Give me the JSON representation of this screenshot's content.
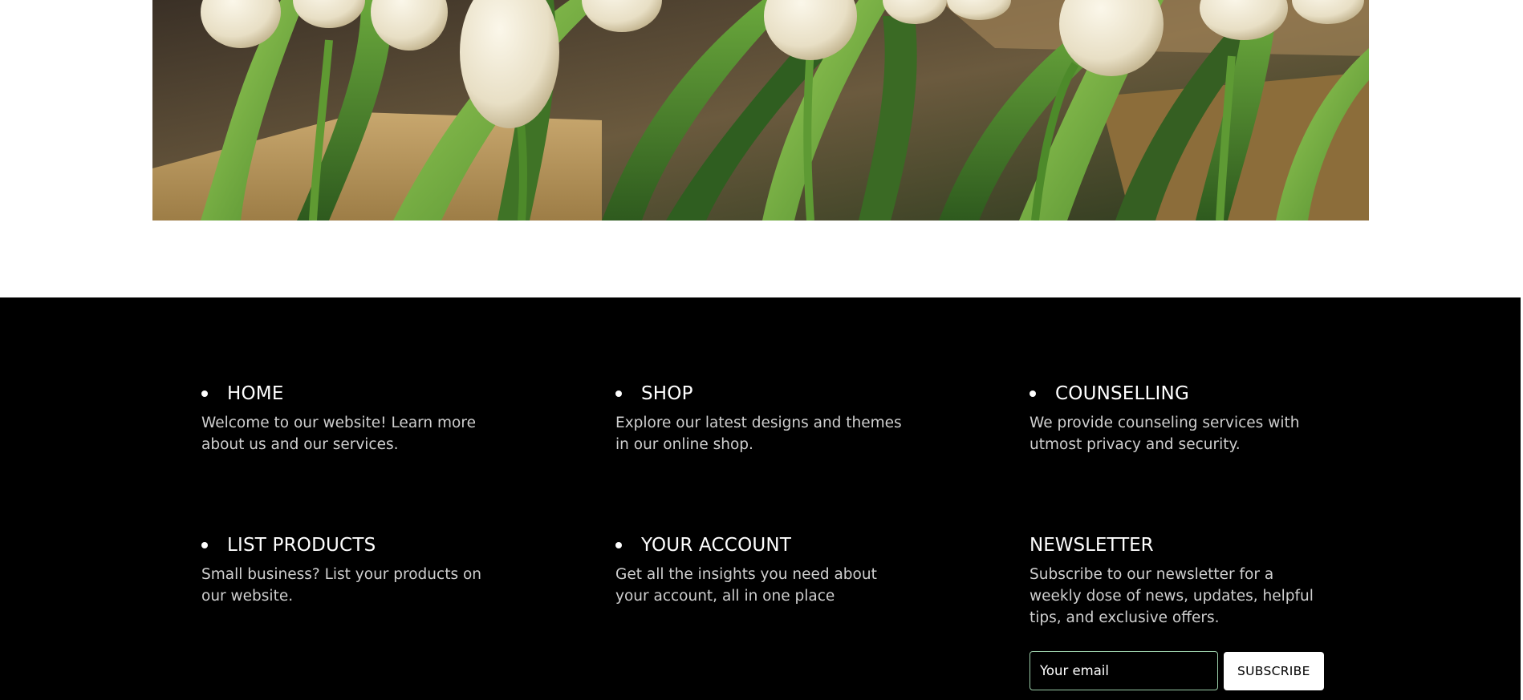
{
  "hero": {
    "image_description": "white-tulips-photo"
  },
  "footer": {
    "links": [
      {
        "label": "HOME",
        "description": "Welcome to our website! Learn more about us and our services."
      },
      {
        "label": "SHOP",
        "description": "Explore our latest designs and themes in our online shop."
      },
      {
        "label": "COUNSELLING",
        "description": "We provide counseling services with utmost privacy and security."
      },
      {
        "label": "LIST PRODUCTS",
        "description": "Small business? List your products on our website."
      },
      {
        "label": "YOUR ACCOUNT",
        "description": "Get all the insights you need about your account, all in one place"
      }
    ],
    "newsletter": {
      "title": "NEWSLETTER",
      "description": "Subscribe to our newsletter for a weekly dose of news, updates, helpful tips, and exclusive offers.",
      "email_placeholder": "Your email",
      "email_value": "",
      "button_label": "SUBSCRIBE"
    }
  },
  "colors": {
    "footer_bg": "#000000",
    "text_primary": "#ffffff",
    "text_secondary": "#cfcfcf",
    "input_border": "#9acda8"
  }
}
